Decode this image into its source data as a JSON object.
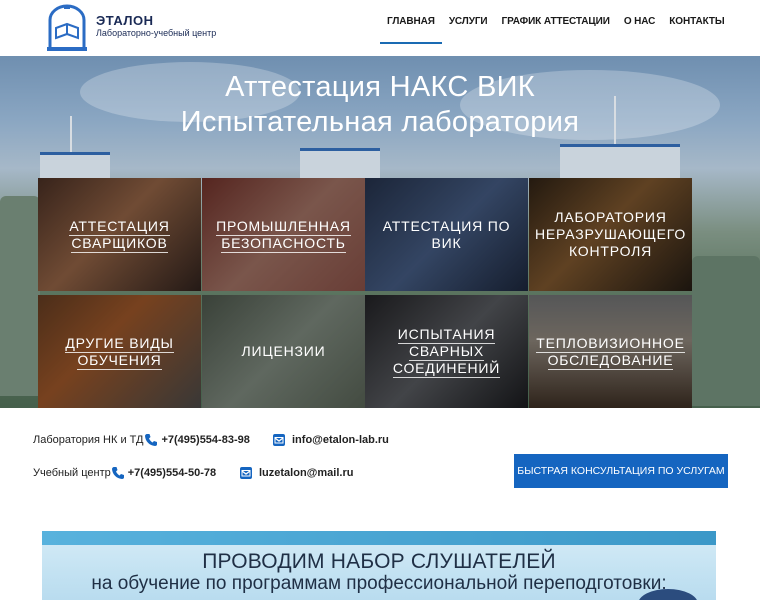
{
  "header": {
    "logo_title": "ЭТАЛОН",
    "logo_subtitle": "Лабораторно-учебный центр",
    "nav": [
      {
        "label": "ГЛАВНАЯ",
        "active": true
      },
      {
        "label": "УСЛУГИ",
        "active": false
      },
      {
        "label": "ГРАФИК АТТЕСТАЦИИ",
        "active": false
      },
      {
        "label": "О НАС",
        "active": false
      },
      {
        "label": "КОНТАКТЫ",
        "active": false
      }
    ]
  },
  "hero": {
    "title_line1": "Аттестация НАКС ВИК",
    "title_line2": "Испытательная лаборатория",
    "tiles": [
      {
        "label": "Аттестация сварщиков",
        "icon": "welding-photo"
      },
      {
        "label": "Промышленная безопасность",
        "icon": "documents-photo"
      },
      {
        "label": "Аттестация по ВИК",
        "icon": "inspection-photo"
      },
      {
        "label": "Лаборатория неразрушающего контроля",
        "icon": "lab-photo"
      },
      {
        "label": "Другие виды обучения",
        "icon": "workers-photo"
      },
      {
        "label": "Лицензии",
        "icon": "license-photo"
      },
      {
        "label": "Испытания сварных соединений",
        "icon": "testing-machine-photo"
      },
      {
        "label": "Тепловизионное обследование",
        "icon": "house-photo"
      }
    ]
  },
  "contacts": {
    "lab_label": "Лаборатория НК и ТД",
    "lab_phone": "+7(495)554-83-98",
    "lab_email": "info@etalon-lab.ru",
    "edu_label": "Учебный центр",
    "edu_phone": "+7(495)554-50-78",
    "edu_email": "luzetalon@mail.ru",
    "cta_button": "БЫСТРАЯ КОНСУЛЬТАЦИЯ ПО УСЛУГАМ"
  },
  "banner": {
    "line1": "ПРОВОДИМ НАБОР СЛУШАТЕЛЕЙ",
    "line2": "на обучение по программам профессиональной переподготовки:"
  },
  "colors": {
    "accent": "#1565c0",
    "nav_active": "#1a6bb3",
    "logo": "#1a2a55"
  }
}
